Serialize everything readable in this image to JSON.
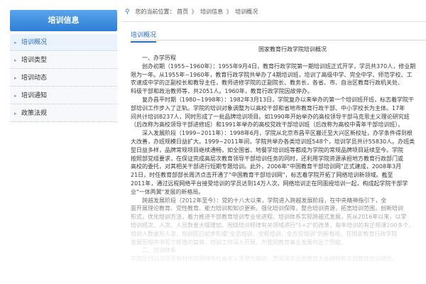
{
  "sidebar": {
    "header": "培训信息",
    "items": [
      {
        "label": "培训概况",
        "active": true
      },
      {
        "label": "培训类型",
        "active": false
      },
      {
        "label": "培训动态",
        "active": false
      },
      {
        "label": "培训通知",
        "active": false
      },
      {
        "label": "政策法规",
        "active": false
      }
    ]
  },
  "breadcrumb": {
    "prefix": "您的当前位置：",
    "items": [
      "首页",
      "培训信息",
      "培训概况"
    ],
    "separator": "》"
  },
  "section": {
    "tab_label": "培训概况"
  },
  "article": {
    "title": "国家教育行政学院培训概况",
    "lines": [
      {
        "text": "一、办学历程",
        "style": "subhead"
      },
      {
        "text": "创办初期（1955~1960年）：1955年9月4日，教育行政学院第一期培训班正式开学，学员共370人，修业期",
        "style": "indent"
      },
      {
        "text": "限为一年。从1955年~1960年，教育行政学院共举办了4期培训班，培训了高级中学、完全中学、师范学校、工",
        "style": "plain"
      },
      {
        "text": "农速成中学的正副校长和教导主任，教师进修学院的正副院长、教务长，各省、市、自治区教育行政机关处、",
        "style": "plain"
      },
      {
        "text": "科级干部和政治教师等，共2051人。1960年，教育行政学院因故停办。",
        "style": "plain"
      },
      {
        "text": "复办昌平时期（1980~1998年）：1982年3月13日，学院复办以来举办的第一个培训班开班，标志着学院干",
        "style": "indent"
      },
      {
        "text": "部培训工作步入了正轨。学院的培训对象调整为以高校干部和省地市教育行政干部、中小学校长为主体。17年",
        "style": "plain"
      },
      {
        "text": "间共计培训8237人，同时形成了一批品牌培训项目。如1990年开始举办的高校领导干部马克思主义理论研究班",
        "style": "plain"
      },
      {
        "text": "（后改称为高校领导干部进修班）和1991年举办的高校党政干部培训班（后改称为高校中青年干部培训班）。",
        "style": "plain"
      },
      {
        "text": "深入发展阶段（1999~2011年）：1998年6月，学院从北京市昌平区搬迁至大兴区新校址，办学条件得到根",
        "style": "indent"
      },
      {
        "text": "大改善，办班规模日益扩大。1999~2011年间，学院共举办各类培训班548个，培训学员共计55830人。办班类",
        "style": "plain"
      },
      {
        "text": "型日益多样，品牌常规项目继续通畅，如全国省、地餐学培训班等都成为学院的常规品牌项目延续至今。学院",
        "style": "plain"
      },
      {
        "text": "按照部党组要求，在保证完成高层次教育领导干部培训任务的同时，还利用学院资源承担地方教育行政部门或",
        "style": "plain"
      },
      {
        "text": "高校的委托，对其相关干部进行短期专题培训。此外，2006年\"中国教育干部培训网\"正式建成，2008年3月",
        "style": "plain"
      },
      {
        "text": "21日，时任教育部部长周济点击开通了\"中国教育干部培训网\"，标志着学院开拓了网络培训新领域。截至",
        "style": "plain"
      },
      {
        "text": "2011年，通过远程网络平台接受培训的学员达到14万人次。网络培训正在同面授培训一起，构成起学院干部学",
        "style": "plain"
      },
      {
        "text": "业\"一体两翼\"发展的新格局。",
        "style": "plain"
      },
      {
        "text": "跨越发展阶段（2012年至今）：党的十八大以来，学院进入跨越发展阶段，在中央精神指引下，全",
        "style": "indent"
      },
      {
        "text": "面开展理论教育、党性教育、能力培训和知识更新。强化培训保障，整合培训资源，拓宽培训范围，创新培训",
        "style": "plain"
      },
      {
        "text": "形式，优化培训方法，着力推进干部教育培训专业化进程。培训体系实现跨越式发展，先从2016年以来，以学",
        "style": "plain"
      },
      {
        "text": "培训班次、人次、人员数量大幅增加。围绕培训规律有关领域进行\"1+2\"的改革，每年培训的有正规课200多个，",
        "style": "plain"
      },
      {
        "text": "培训人数逾万人次，培训区已初步形成\"全员培训、全程培训、全方位培训\"的新格局，在国家教育行政学院",
        "style": "plain"
      },
      {
        "text": "发展历程中书写了辉煌的篇章，培训工作深入开展，为我国教育事业发展作出了贡献。",
        "style": "plain"
      },
      {
        "text": "二、培训体系",
        "style": "subhead"
      },
      {
        "text": "学院坚持以习近平新时代中国特色社会主义思想为指导，贯彻落实全国教育大会精神和干部教育培训规划。",
        "style": "plain"
      }
    ]
  },
  "colors": {
    "accent": "#2b6fc2",
    "header_bg": "#3c8fe0"
  }
}
